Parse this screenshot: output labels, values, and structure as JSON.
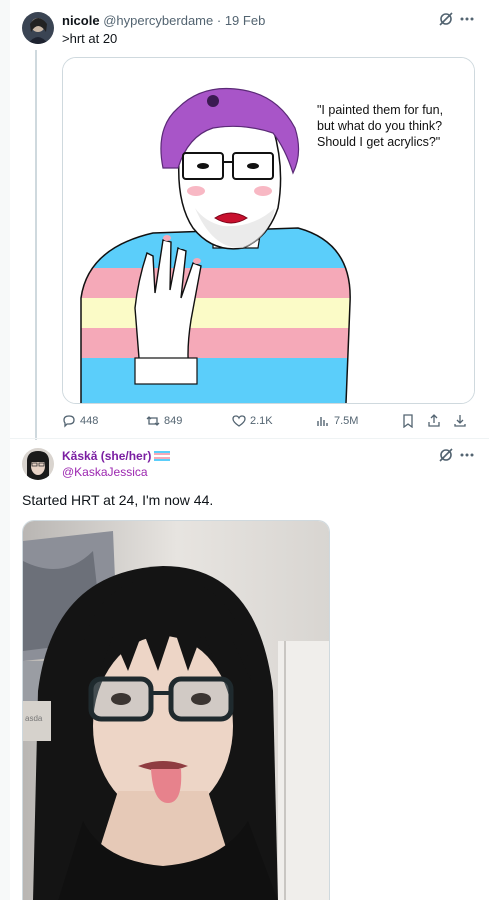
{
  "tweet1": {
    "display_name": "nicole",
    "handle": "@hypercyberdame",
    "separator": "·",
    "date": "19 Feb",
    "text": ">hrt at 20",
    "image_caption": "\"I painted them for fun,\nbut what do you think?\nShould I get acrylics?\"",
    "replies": "448",
    "reposts": "849",
    "likes": "2.1K",
    "views": "7.5M"
  },
  "tweet2": {
    "display_name": "Kăskă (she/her)",
    "handle": "@KaskaJessica",
    "text": "Started HRT at 24, I'm now 44.",
    "photo_sign_text": "asda"
  },
  "icons": {
    "grok": "grok-icon",
    "more": "more-icon",
    "reply": "reply-icon",
    "repost": "repost-icon",
    "like": "heart-icon",
    "views": "views-icon",
    "bookmark": "bookmark-icon",
    "share": "share-icon",
    "download": "download-icon",
    "flag": "trans-flag-icon"
  },
  "colors": {
    "accent_name": "#7b1fa2",
    "trans_blue": "#5bcefa",
    "trans_pink": "#f5a9b8",
    "text_muted": "#536471"
  }
}
